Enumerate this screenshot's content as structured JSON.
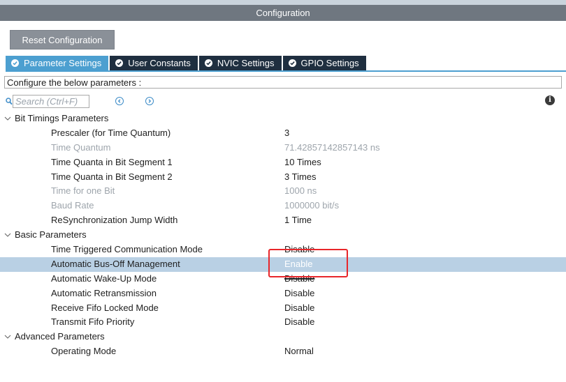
{
  "window": {
    "title": "Configuration"
  },
  "toolbar": {
    "reset_label": "Reset Configuration"
  },
  "tabs": [
    {
      "label": "Parameter Settings",
      "active": true
    },
    {
      "label": "User Constants",
      "active": false
    },
    {
      "label": "NVIC Settings",
      "active": false
    },
    {
      "label": "GPIO Settings",
      "active": false
    }
  ],
  "description": "Configure the below parameters :",
  "search": {
    "placeholder": "Search (Ctrl+F)",
    "value": ""
  },
  "groups": [
    {
      "label": "Bit Timings Parameters",
      "params": [
        {
          "label": "Prescaler (for Time Quantum)",
          "value": "3",
          "enabled": true
        },
        {
          "label": "Time Quantum",
          "value": "71.42857142857143 ns",
          "enabled": false
        },
        {
          "label": "Time Quanta in Bit Segment 1",
          "value": "10 Times",
          "enabled": true
        },
        {
          "label": "Time Quanta in Bit Segment 2",
          "value": "3 Times",
          "enabled": true
        },
        {
          "label": "Time for one Bit",
          "value": "1000 ns",
          "enabled": false
        },
        {
          "label": "Baud Rate",
          "value": "1000000 bit/s",
          "enabled": false
        },
        {
          "label": "ReSynchronization Jump Width",
          "value": "1 Time",
          "enabled": true
        }
      ]
    },
    {
      "label": "Basic Parameters",
      "params": [
        {
          "label": "Time Triggered Communication Mode",
          "value": "Disable",
          "enabled": true
        },
        {
          "label": "Automatic Bus-Off Management",
          "value": "Enable",
          "enabled": true,
          "selected": true
        },
        {
          "label": "Automatic Wake-Up Mode",
          "value": "Disable",
          "enabled": true
        },
        {
          "label": "Automatic Retransmission",
          "value": "Disable",
          "enabled": true
        },
        {
          "label": "Receive Fifo Locked Mode",
          "value": "Disable",
          "enabled": true
        },
        {
          "label": "Transmit Fifo Priority",
          "value": "Disable",
          "enabled": true
        }
      ]
    },
    {
      "label": "Advanced Parameters",
      "params": [
        {
          "label": "Operating Mode",
          "value": "Normal",
          "enabled": true
        }
      ]
    }
  ],
  "colors": {
    "tab_active": "#4c9fd0",
    "tab_inactive": "#1f2f40",
    "selection": "#b9d0e4",
    "highlight_box": "#e8262a"
  },
  "icons": {
    "tab": "check-circle-icon",
    "search": "search-icon",
    "prev": "chevron-left-circle-icon",
    "next": "chevron-right-circle-icon",
    "info": "info-icon",
    "group": "chevron-down-icon"
  }
}
